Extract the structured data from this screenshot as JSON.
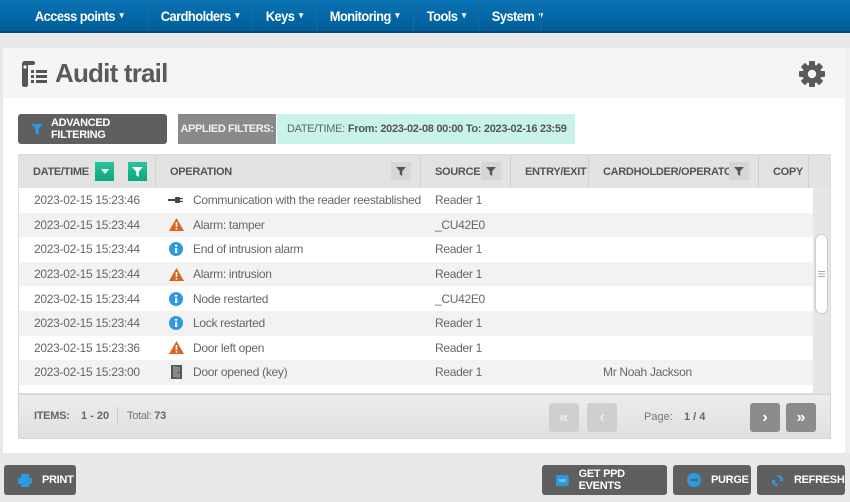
{
  "nav": {
    "items": [
      {
        "label": "Access points"
      },
      {
        "label": "Cardholders"
      },
      {
        "label": "Keys"
      },
      {
        "label": "Monitoring"
      },
      {
        "label": "Tools"
      },
      {
        "label": "System"
      }
    ],
    "chevron": "▾"
  },
  "header": {
    "title": "Audit trail",
    "title_icon": "audit-trail-icon",
    "settings_icon": "gear-icon"
  },
  "filters": {
    "advanced_label": "ADVANCED FILTERING",
    "applied_label": "APPLIED FILTERS:",
    "applied_key": "DATE/TIME:",
    "applied_value": "From: 2023-02-08 00:00 To: 2023-02-16 23:59"
  },
  "grid": {
    "columns": [
      {
        "label": "DATE/TIME"
      },
      {
        "label": "OPERATION"
      },
      {
        "label": "SOURCE"
      },
      {
        "label": "ENTRY/EXIT"
      },
      {
        "label": "CARDHOLDER/OPERATOR"
      },
      {
        "label": "COPY"
      }
    ],
    "rows": [
      {
        "datetime": "2023-02-15 15:23:46",
        "icon": "plug-icon",
        "operation": "Communication with the reader reestablished",
        "source": "Reader 1",
        "entry_exit": "",
        "cardholder": "",
        "copy": ""
      },
      {
        "datetime": "2023-02-15 15:23:44",
        "icon": "warning-icon",
        "operation": "Alarm: tamper",
        "source": "_CU42E0",
        "entry_exit": "",
        "cardholder": "",
        "copy": ""
      },
      {
        "datetime": "2023-02-15 15:23:44",
        "icon": "info-icon",
        "operation": "End of intrusion alarm",
        "source": "Reader 1",
        "entry_exit": "",
        "cardholder": "",
        "copy": ""
      },
      {
        "datetime": "2023-02-15 15:23:44",
        "icon": "warning-icon",
        "operation": "Alarm: intrusion",
        "source": "Reader 1",
        "entry_exit": "",
        "cardholder": "",
        "copy": ""
      },
      {
        "datetime": "2023-02-15 15:23:44",
        "icon": "info-icon",
        "operation": "Node restarted",
        "source": "_CU42E0",
        "entry_exit": "",
        "cardholder": "",
        "copy": ""
      },
      {
        "datetime": "2023-02-15 15:23:44",
        "icon": "info-icon",
        "operation": "Lock restarted",
        "source": "Reader 1",
        "entry_exit": "",
        "cardholder": "",
        "copy": ""
      },
      {
        "datetime": "2023-02-15 15:23:36",
        "icon": "warning-icon",
        "operation": "Door left open",
        "source": "Reader 1",
        "entry_exit": "",
        "cardholder": "",
        "copy": ""
      },
      {
        "datetime": "2023-02-15 15:23:00",
        "icon": "door-icon",
        "operation": "Door opened (key)",
        "source": "Reader 1",
        "entry_exit": "",
        "cardholder": "Mr Noah Jackson",
        "copy": ""
      }
    ]
  },
  "footer": {
    "items_label": "ITEMS:",
    "items_range": "1 - 20",
    "total_label": "Total:",
    "total_value": "73",
    "page_label": "Page:",
    "page_value": "1 / 4",
    "first": "«",
    "prev": "‹",
    "next": "›",
    "last": "»"
  },
  "actions": {
    "print": "PRINT",
    "get_ppd": "GET PPD EVENTS",
    "purge": "PURGE",
    "refresh": "REFRESH"
  },
  "colors": {
    "nav_bg": "#0a72b3",
    "accent_green": "#1ab48d",
    "applied_bg": "#c9f2ea",
    "warning": "#d9641e",
    "info": "#2a9be0",
    "button_dark": "#5f5f5f"
  }
}
